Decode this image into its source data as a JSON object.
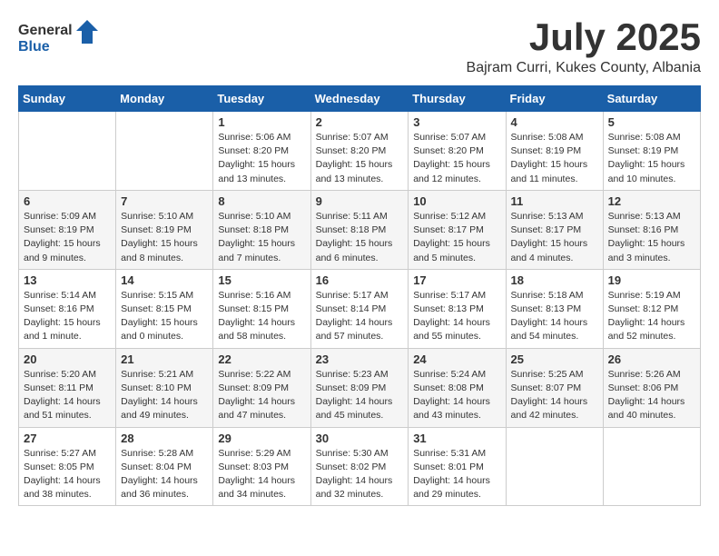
{
  "logo": {
    "general": "General",
    "blue": "Blue"
  },
  "title": {
    "month_year": "July 2025",
    "location": "Bajram Curri, Kukes County, Albania"
  },
  "days_of_week": [
    "Sunday",
    "Monday",
    "Tuesday",
    "Wednesday",
    "Thursday",
    "Friday",
    "Saturday"
  ],
  "weeks": [
    [
      {
        "day": "",
        "content": ""
      },
      {
        "day": "",
        "content": ""
      },
      {
        "day": "1",
        "content": "Sunrise: 5:06 AM\nSunset: 8:20 PM\nDaylight: 15 hours and 13 minutes."
      },
      {
        "day": "2",
        "content": "Sunrise: 5:07 AM\nSunset: 8:20 PM\nDaylight: 15 hours and 13 minutes."
      },
      {
        "day": "3",
        "content": "Sunrise: 5:07 AM\nSunset: 8:20 PM\nDaylight: 15 hours and 12 minutes."
      },
      {
        "day": "4",
        "content": "Sunrise: 5:08 AM\nSunset: 8:19 PM\nDaylight: 15 hours and 11 minutes."
      },
      {
        "day": "5",
        "content": "Sunrise: 5:08 AM\nSunset: 8:19 PM\nDaylight: 15 hours and 10 minutes."
      }
    ],
    [
      {
        "day": "6",
        "content": "Sunrise: 5:09 AM\nSunset: 8:19 PM\nDaylight: 15 hours and 9 minutes."
      },
      {
        "day": "7",
        "content": "Sunrise: 5:10 AM\nSunset: 8:19 PM\nDaylight: 15 hours and 8 minutes."
      },
      {
        "day": "8",
        "content": "Sunrise: 5:10 AM\nSunset: 8:18 PM\nDaylight: 15 hours and 7 minutes."
      },
      {
        "day": "9",
        "content": "Sunrise: 5:11 AM\nSunset: 8:18 PM\nDaylight: 15 hours and 6 minutes."
      },
      {
        "day": "10",
        "content": "Sunrise: 5:12 AM\nSunset: 8:17 PM\nDaylight: 15 hours and 5 minutes."
      },
      {
        "day": "11",
        "content": "Sunrise: 5:13 AM\nSunset: 8:17 PM\nDaylight: 15 hours and 4 minutes."
      },
      {
        "day": "12",
        "content": "Sunrise: 5:13 AM\nSunset: 8:16 PM\nDaylight: 15 hours and 3 minutes."
      }
    ],
    [
      {
        "day": "13",
        "content": "Sunrise: 5:14 AM\nSunset: 8:16 PM\nDaylight: 15 hours and 1 minute."
      },
      {
        "day": "14",
        "content": "Sunrise: 5:15 AM\nSunset: 8:15 PM\nDaylight: 15 hours and 0 minutes."
      },
      {
        "day": "15",
        "content": "Sunrise: 5:16 AM\nSunset: 8:15 PM\nDaylight: 14 hours and 58 minutes."
      },
      {
        "day": "16",
        "content": "Sunrise: 5:17 AM\nSunset: 8:14 PM\nDaylight: 14 hours and 57 minutes."
      },
      {
        "day": "17",
        "content": "Sunrise: 5:17 AM\nSunset: 8:13 PM\nDaylight: 14 hours and 55 minutes."
      },
      {
        "day": "18",
        "content": "Sunrise: 5:18 AM\nSunset: 8:13 PM\nDaylight: 14 hours and 54 minutes."
      },
      {
        "day": "19",
        "content": "Sunrise: 5:19 AM\nSunset: 8:12 PM\nDaylight: 14 hours and 52 minutes."
      }
    ],
    [
      {
        "day": "20",
        "content": "Sunrise: 5:20 AM\nSunset: 8:11 PM\nDaylight: 14 hours and 51 minutes."
      },
      {
        "day": "21",
        "content": "Sunrise: 5:21 AM\nSunset: 8:10 PM\nDaylight: 14 hours and 49 minutes."
      },
      {
        "day": "22",
        "content": "Sunrise: 5:22 AM\nSunset: 8:09 PM\nDaylight: 14 hours and 47 minutes."
      },
      {
        "day": "23",
        "content": "Sunrise: 5:23 AM\nSunset: 8:09 PM\nDaylight: 14 hours and 45 minutes."
      },
      {
        "day": "24",
        "content": "Sunrise: 5:24 AM\nSunset: 8:08 PM\nDaylight: 14 hours and 43 minutes."
      },
      {
        "day": "25",
        "content": "Sunrise: 5:25 AM\nSunset: 8:07 PM\nDaylight: 14 hours and 42 minutes."
      },
      {
        "day": "26",
        "content": "Sunrise: 5:26 AM\nSunset: 8:06 PM\nDaylight: 14 hours and 40 minutes."
      }
    ],
    [
      {
        "day": "27",
        "content": "Sunrise: 5:27 AM\nSunset: 8:05 PM\nDaylight: 14 hours and 38 minutes."
      },
      {
        "day": "28",
        "content": "Sunrise: 5:28 AM\nSunset: 8:04 PM\nDaylight: 14 hours and 36 minutes."
      },
      {
        "day": "29",
        "content": "Sunrise: 5:29 AM\nSunset: 8:03 PM\nDaylight: 14 hours and 34 minutes."
      },
      {
        "day": "30",
        "content": "Sunrise: 5:30 AM\nSunset: 8:02 PM\nDaylight: 14 hours and 32 minutes."
      },
      {
        "day": "31",
        "content": "Sunrise: 5:31 AM\nSunset: 8:01 PM\nDaylight: 14 hours and 29 minutes."
      },
      {
        "day": "",
        "content": ""
      },
      {
        "day": "",
        "content": ""
      }
    ]
  ]
}
